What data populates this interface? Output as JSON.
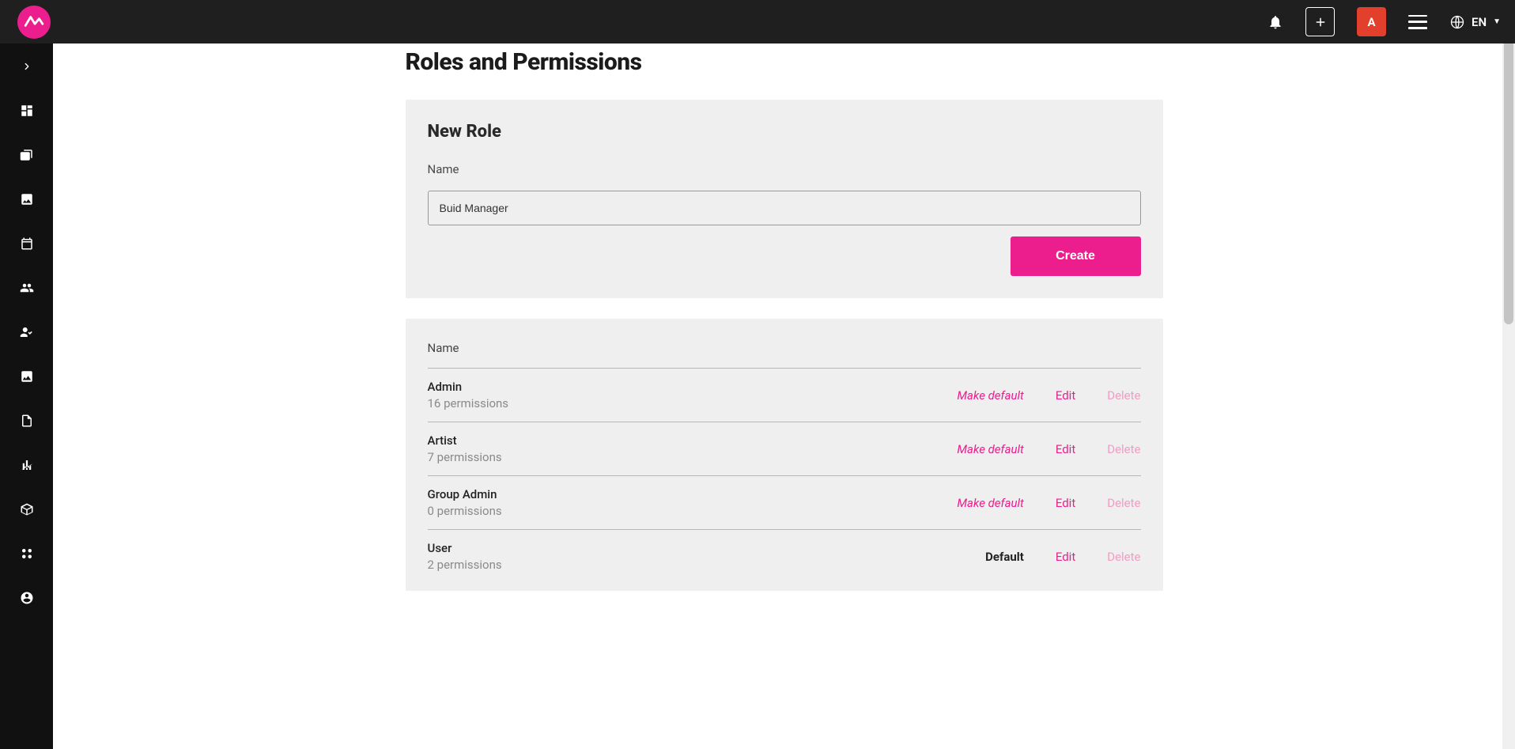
{
  "colors": {
    "accent": "#ec1e8d",
    "danger": "#e2402c"
  },
  "topbar": {
    "avatar_initial": "A",
    "language": "EN"
  },
  "page": {
    "title": "Roles and Permissions"
  },
  "newRole": {
    "heading": "New Role",
    "fieldLabel": "Name",
    "value": "Buid Manager",
    "createLabel": "Create"
  },
  "rolesList": {
    "header": "Name",
    "makeDefaultLabel": "Make default",
    "defaultLabel": "Default",
    "editLabel": "Edit",
    "deleteLabel": "Delete",
    "items": [
      {
        "name": "Admin",
        "perms": "16 permissions",
        "isDefault": false
      },
      {
        "name": "Artist",
        "perms": "7 permissions",
        "isDefault": false
      },
      {
        "name": "Group Admin",
        "perms": "0 permissions",
        "isDefault": false
      },
      {
        "name": "User",
        "perms": "2 permissions",
        "isDefault": true
      }
    ]
  }
}
